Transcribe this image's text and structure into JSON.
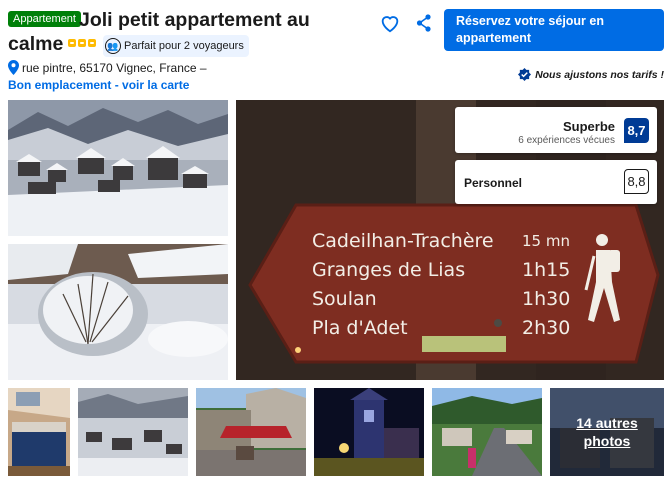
{
  "header": {
    "type_badge": "Appartement",
    "title_line1": "Joli petit appartement au",
    "title_line2": "calme",
    "persons_label": "Parfait pour 2 voyageurs",
    "star_count": 3
  },
  "actions": {
    "favorite_icon": "heart-icon",
    "share_icon": "share-icon",
    "book_button": "Réservez votre séjour en appartement"
  },
  "location": {
    "address": "rue pintre, 65170 Vignec, France –",
    "map_link": "Bon emplacement - voir la carte"
  },
  "price_note": "Nous ajustons nos tarifs !",
  "reviews": {
    "overall_word": "Superbe",
    "overall_count": "6 expériences vécues",
    "overall_score": "8,7",
    "staff_label": "Personnel",
    "staff_score": "8,8"
  },
  "main_photo_sign": {
    "rows": [
      {
        "place": "Cadeilhan-Trachère",
        "time": "15 mn"
      },
      {
        "place": "Granges de Lias",
        "time": "1h15"
      },
      {
        "place": "Soulan",
        "time": "1h30"
      },
      {
        "place": "Pla d'Adet",
        "time": "2h30"
      }
    ]
  },
  "gallery": {
    "more_line1": "14 autres",
    "more_line2": "photos"
  },
  "colors": {
    "brand_blue": "#006ce4",
    "score_navy": "#003b95",
    "green_badge": "#008009",
    "star_yellow": "#febb02"
  }
}
